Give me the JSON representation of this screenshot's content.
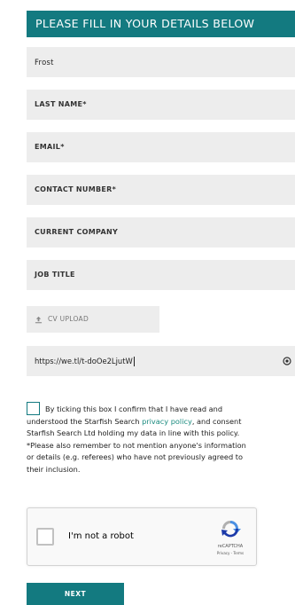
{
  "header": {
    "title": "PLEASE FILL IN YOUR DETAILS BELOW"
  },
  "form": {
    "first_name_value": "Frost",
    "last_name_placeholder": "LAST NAME*",
    "email_placeholder": "EMAIL*",
    "contact_number_placeholder": "CONTACT NUMBER*",
    "current_company_placeholder": "CURRENT COMPANY",
    "job_title_placeholder": "JOB TITLE",
    "cv_upload_label": "CV UPLOAD",
    "url_value": "https://we.tl/t-doOe2LjutW"
  },
  "consent": {
    "line1": "By ticking this box I confirm that I have read and",
    "line2_pre": "understood the Starfish Search ",
    "line2_link": "privacy policy",
    "line2_post": ", and consent",
    "line3": "Starfish Search Ltd holding my data in line with this policy.",
    "line4": "*Please also remember to not mention anyone's information",
    "line5": "or details (e.g. referees) who have not previously agreed to",
    "line6": "their inclusion."
  },
  "recaptcha": {
    "label": "I'm not a robot",
    "brand": "reCAPTCHA",
    "links": "Privacy - Terms"
  },
  "actions": {
    "next_label": "NEXT"
  },
  "colors": {
    "accent": "#137a80",
    "link": "#1a8b7f",
    "field_bg": "#ededed"
  }
}
